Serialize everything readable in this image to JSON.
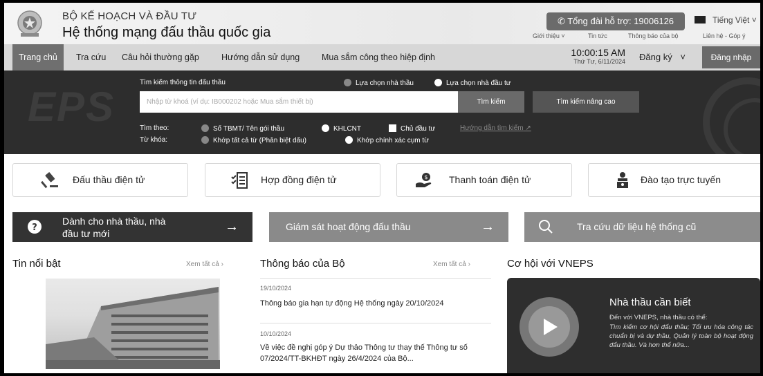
{
  "header": {
    "org_name": "BỘ KẾ HOẠCH VÀ ĐẦU TƯ",
    "system_name": "Hệ thống mạng đấu thầu quốc gia",
    "hotline": "Tổng đài hỗ trợ: 19006126",
    "language": "Tiếng Việt",
    "links": [
      "Giới thiệu",
      "Tin tức",
      "Thông báo của bộ",
      "Liên hệ - Góp ý"
    ]
  },
  "nav": {
    "items": [
      "Trang chủ",
      "Tra cứu",
      "Câu hỏi thường gặp",
      "Hướng dẫn sử dụng",
      "Mua sắm công theo hiệp định"
    ],
    "time": "10:00:15 AM",
    "date": "Thứ Tư, 6/11/2024",
    "register": "Đăng ký",
    "login": "Đăng nhập"
  },
  "search": {
    "title": "Tìm kiếm thông tin đấu thầu",
    "mode_options": [
      "Lựa chọn nhà thầu",
      "Lựa chọn nhà đầu tư"
    ],
    "placeholder": "Nhập từ khoá (ví dụ: IB000202 hoặc Mua sắm thiết bị)",
    "search_button": "Tìm kiếm",
    "advanced_button": "Tìm kiếm nâng cao",
    "find_by_label": "Tìm theo:",
    "find_by_options": [
      "Số TBMT/ Tên gói thầu",
      "KHLCNT",
      "Chủ đầu tư"
    ],
    "guide_link": "Hướng dẫn tìm kiếm",
    "keyword_label": "Từ khóa:",
    "keyword_options": [
      "Khớp tất cả từ (Phân biệt dấu)",
      "Khớp chính xác cụm từ"
    ]
  },
  "features": [
    "Đấu thầu điện tử",
    "Hợp đồng điện tử",
    "Thanh toán điện tử",
    "Đào tạo trực tuyến"
  ],
  "banners": {
    "new_user_line1": "Dành cho nhà thầu, nhà",
    "new_user_line2": "đầu tư mới",
    "monitor": "Giám sát hoạt động đấu thầu",
    "legacy": "Tra cứu dữ liệu hệ thống cũ"
  },
  "sections": {
    "featured_news": "Tin nổi bật",
    "ministry_notices": "Thông báo của Bộ",
    "opportunities": "Cơ hội với VNEPS",
    "see_all": "Xem tất cả"
  },
  "notices": [
    {
      "date": "19/10/2024",
      "title": "Thông báo gia hạn tự động Hệ thống ngày 20/10/2024"
    },
    {
      "date": "10/10/2024",
      "title": "Về việc đề nghị góp ý Dự thảo Thông tư thay thế Thông tư số 07/2024/TT-BKHĐT ngày 26/4/2024 của Bộ..."
    }
  ],
  "promo": {
    "title": "Nhà thầu cần biết",
    "subtitle": "Đến với VNEPS, nhà thầu có thể:",
    "body": "Tìm kiếm cơ hội đấu thầu; Tối ưu hóa công tác chuẩn bị và dự thầu, Quản lý toàn bộ hoạt động đấu thầu. Và hơn thế nữa..."
  },
  "watermark": "EPS",
  "colors": {
    "dark": "#2d2d2d",
    "active_tab": "#6f6f6f",
    "accent_gray": "#8a8a8a"
  }
}
